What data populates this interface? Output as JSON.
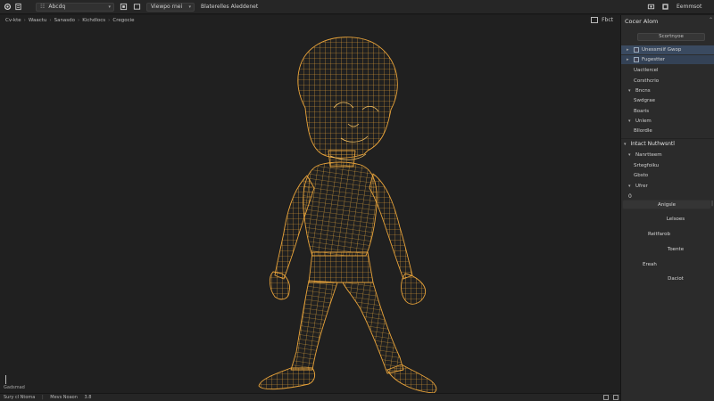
{
  "topbar": {
    "workspace_dropdown": "Abcdq",
    "mode_dropdown": "Viewpo rnei",
    "title": "Blaterelles Aleddenet",
    "right_label": "Eemmsot"
  },
  "viewport": {
    "breadcrumbs": [
      "Cv-kte",
      "Waactu",
      "Sanasdo",
      "Kichdlocs",
      "Cregocie"
    ],
    "tool_label": "Fbct",
    "caption": "Gadsmad"
  },
  "statusbar": {
    "left": "Sury cl Ntoma",
    "middle": "Mevs Noaon",
    "value": "3.8"
  },
  "panel": {
    "title": "Cocer Alom",
    "search_placeholder": "Scortnyoe",
    "tree": [
      {
        "label": "Unessmiif Gwop",
        "arrow": "▸",
        "icon": true,
        "selected": true
      },
      {
        "label": "Fugestter",
        "arrow": "▸",
        "icon": true,
        "selected": true
      },
      {
        "label": "Uactlercel",
        "arrow": "",
        "icon": false,
        "selected": false
      },
      {
        "label": "Corsthcrio",
        "arrow": "",
        "icon": false,
        "selected": false
      },
      {
        "label": "Bncns",
        "arrow": "▾",
        "icon": false,
        "selected": false
      },
      {
        "label": "Swdgrae",
        "arrow": "",
        "icon": false,
        "selected": false
      },
      {
        "label": "Boaris",
        "arrow": "",
        "icon": false,
        "selected": false
      },
      {
        "label": "Unlem",
        "arrow": "▾",
        "icon": false,
        "selected": false
      },
      {
        "label": "Bllordle",
        "arrow": "",
        "icon": false,
        "selected": false
      }
    ],
    "section_title": "Intact Nuthwsntl",
    "section_items": [
      {
        "label": "Nanrtteem",
        "arrow": "▾"
      },
      {
        "label": "Srtegfoiku",
        "arrow": ""
      },
      {
        "label": "Gbsto",
        "arrow": ""
      },
      {
        "label": "Ufrer",
        "arrow": "▾"
      }
    ],
    "index_value": "0",
    "buttons": [
      "Anigsle",
      "Lelsoes",
      "Reitfarob",
      "Toente",
      "Ereah",
      "Daciot"
    ]
  },
  "colors": {
    "wireframe": "#e8a33a",
    "selection": "#3a4a60",
    "background": "#202020"
  }
}
